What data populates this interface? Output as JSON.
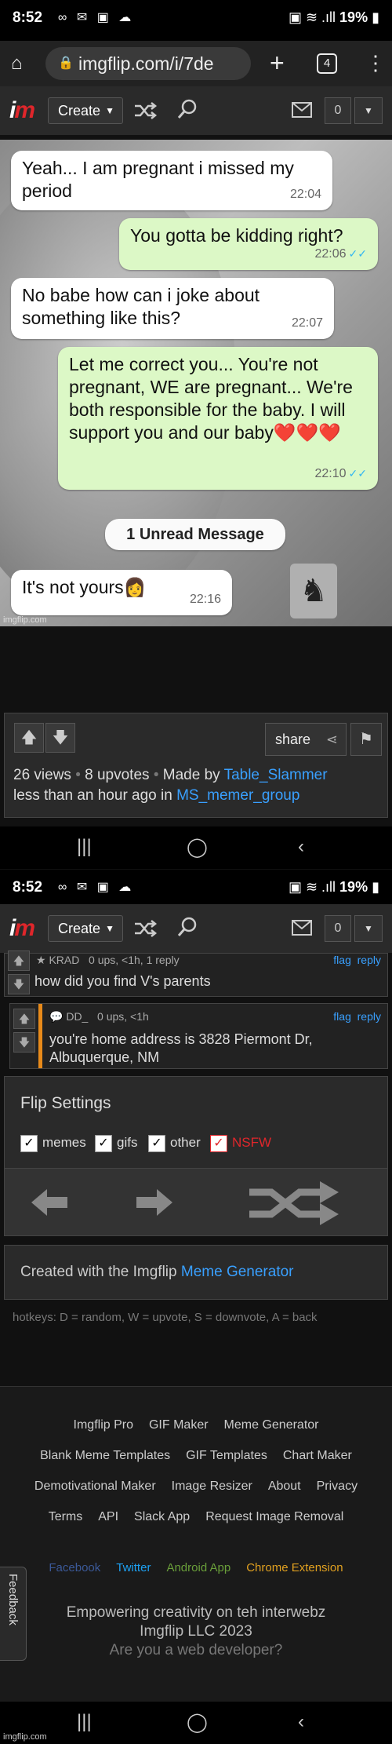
{
  "status": {
    "time": "8:52",
    "icons": "∞ ✉ ▣ ☁",
    "battery": "19%",
    "signal": "▣ ≋ .ıll"
  },
  "browser": {
    "url": "imgflip.com/i/7de",
    "tab_count": "4"
  },
  "header": {
    "create_label": "Create",
    "notification_count": "0"
  },
  "meme": {
    "messages": [
      {
        "dir": "in",
        "text": "Yeah... I am pregnant i missed my period",
        "time": "22:04"
      },
      {
        "dir": "out",
        "text": "You gotta be kidding right?",
        "time": "22:06"
      },
      {
        "dir": "in",
        "text": "No babe how can i joke about something like this?",
        "time": "22:07"
      },
      {
        "dir": "out",
        "text": "Let me correct you... You're not pregnant, WE are pregnant... We're both responsible for the baby. I will support you and our baby❤️❤️❤️",
        "time": "22:10"
      },
      {
        "dir": "in",
        "text": "It's not yours👩",
        "time": "22:16"
      }
    ],
    "unread_label": "1 Unread Message",
    "watermark": "imgflip.com"
  },
  "info": {
    "share_label": "share",
    "views": "26 views",
    "upvotes": "8 upvotes",
    "made_by_prefix": "Made by",
    "author": "Table_Slammer",
    "time_prefix": "less than an hour ago in",
    "stream": "MS_memer_group"
  },
  "comments": [
    {
      "user": "KRAD",
      "meta": "0 ups, <1h, 1 reply",
      "text": "how did you find V's parents",
      "flag": "flag",
      "reply": "reply"
    },
    {
      "user": "DD_",
      "meta": "0 ups, <1h",
      "text": "you're home address is 3828 Piermont Dr, Albuquerque, NM",
      "flag": "flag",
      "reply": "reply"
    }
  ],
  "flip": {
    "title": "Flip Settings",
    "options": [
      {
        "label": "memes",
        "checked": true
      },
      {
        "label": "gifs",
        "checked": true
      },
      {
        "label": "other",
        "checked": true
      },
      {
        "label": "NSFW",
        "checked": true
      }
    ]
  },
  "created": {
    "prefix": "Created with the Imgflip",
    "link": "Meme Generator"
  },
  "hotkeys": "hotkeys: D = random, W = upvote, S = downvote, A = back",
  "footer": {
    "row1": [
      "Imgflip Pro",
      "GIF Maker",
      "Meme Generator"
    ],
    "row2": [
      "Blank Meme Templates",
      "GIF Templates",
      "Chart Maker"
    ],
    "row3": [
      "Demotivational Maker",
      "Image Resizer",
      "About",
      "Privacy"
    ],
    "row4": [
      "Terms",
      "API",
      "Slack App",
      "Request Image Removal"
    ],
    "social": [
      {
        "label": "Facebook",
        "color": "#3b5998"
      },
      {
        "label": "Twitter",
        "color": "#1da1f2"
      },
      {
        "label": "Android App",
        "color": "#6a9f3a"
      },
      {
        "label": "Chrome Extension",
        "color": "#e0a020"
      }
    ],
    "tagline1": "Empowering creativity on teh interwebz",
    "tagline2": "Imgflip LLC 2023",
    "tagline3": "Are you a web developer?",
    "feedback": "Feedback",
    "watermark": "imgflip.com"
  }
}
